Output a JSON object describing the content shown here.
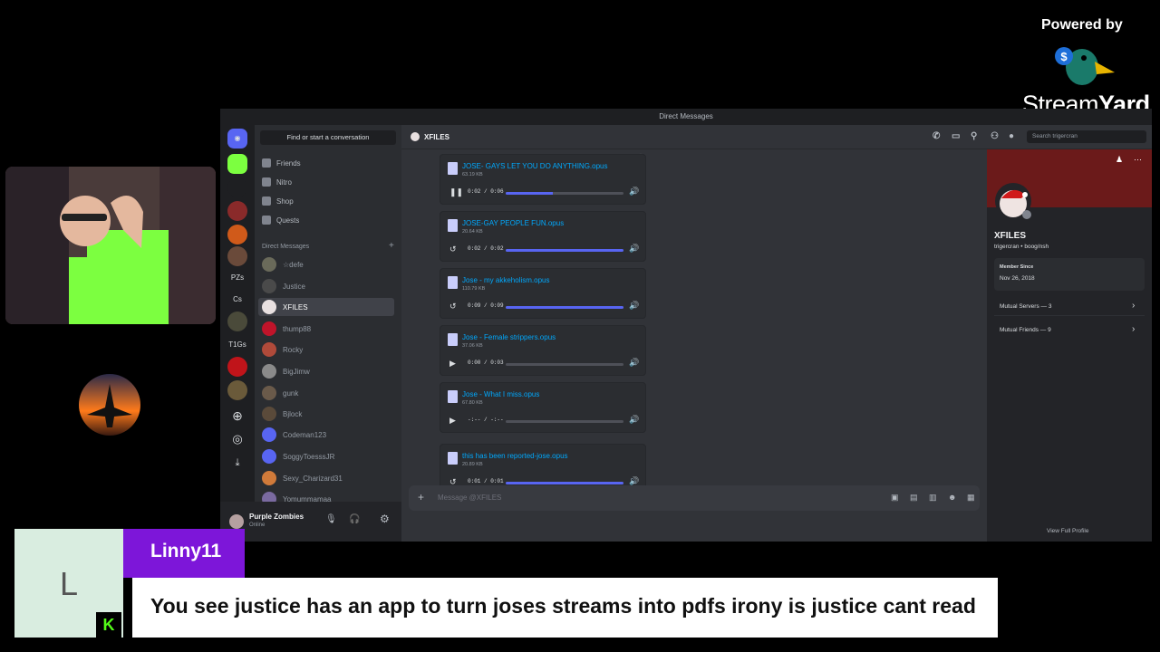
{
  "branding": {
    "powered_by": "Powered by",
    "wordmark_light": "Stream",
    "wordmark_bold": "Yard",
    "brand_color": "#1e90ff"
  },
  "discord": {
    "window_title": "Direct Messages",
    "finder_placeholder": "Find or start a conversation",
    "nav": [
      {
        "label": "Friends",
        "icon": "friends-icon"
      },
      {
        "label": "Nitro",
        "icon": "nitro-icon"
      },
      {
        "label": "Shop",
        "icon": "shop-icon"
      },
      {
        "label": "Quests",
        "icon": "quests-icon"
      }
    ],
    "dm_header": "Direct Messages",
    "dms": [
      {
        "name": "☆defe"
      },
      {
        "name": "Justice"
      },
      {
        "name": "XFILES",
        "active": true
      },
      {
        "name": "thump88"
      },
      {
        "name": "Rocky"
      },
      {
        "name": "BigJimw"
      },
      {
        "name": "gunk"
      },
      {
        "name": "Bjlock"
      },
      {
        "name": "Codeman123"
      },
      {
        "name": "SoggyToesssJR"
      },
      {
        "name": "Sexy_Charizard31"
      },
      {
        "name": "Yomummamaa"
      }
    ],
    "guild_labels": [
      "PZs",
      "Cs",
      "T1Gs"
    ],
    "user": {
      "name": "Purple Zombies",
      "status": "Online"
    },
    "chat": {
      "channel": "XFILES",
      "search_placeholder": "Search trigercran",
      "composer_placeholder": "Message @XFILES",
      "attachments": [
        {
          "name": "JOSE- GAYS LET YOU DO ANYTHING.opus",
          "size": "63.19 KB",
          "time": "0:02 / 0:06",
          "progress": 0.4,
          "state": "pause"
        },
        {
          "name": "JOSE-GAY PEOPLE FUN.opus",
          "size": "20.64 KB",
          "time": "0:02 / 0:02",
          "progress": 1.0,
          "state": "replay"
        },
        {
          "name": "Jose - my akkeholism.opus",
          "size": "110.79 KB",
          "time": "0:09 / 0:09",
          "progress": 1.0,
          "state": "replay"
        },
        {
          "name": "Jose - Female strippers.opus",
          "size": "37.06 KB",
          "time": "0:00 / 0:03",
          "progress": 0.0,
          "state": "play"
        },
        {
          "name": "Jose - What I miss.opus",
          "size": "67.80 KB",
          "time": "-:-- / -:--",
          "progress": 0.0,
          "state": "play"
        },
        {
          "name": "this has been reported-jose.opus",
          "size": "20.89 KB",
          "time": "0:01 / 0:01",
          "progress": 1.0,
          "state": "replay"
        }
      ]
    },
    "profile": {
      "name": "XFILES",
      "tags": "trigercran • boog/nsh",
      "member_since_label": "Member Since",
      "member_since": "Nov 26, 2018",
      "mutual_servers": "Mutual Servers — 3",
      "mutual_friends": "Mutual Friends — 9",
      "view_full": "View Full Profile"
    }
  },
  "comment": {
    "initial": "L",
    "author": "Linny11",
    "text": "You see justice has an app to turn joses streams into pdfs irony is justice cant read",
    "platform_badge": "K",
    "author_color": "#7d16d9"
  }
}
